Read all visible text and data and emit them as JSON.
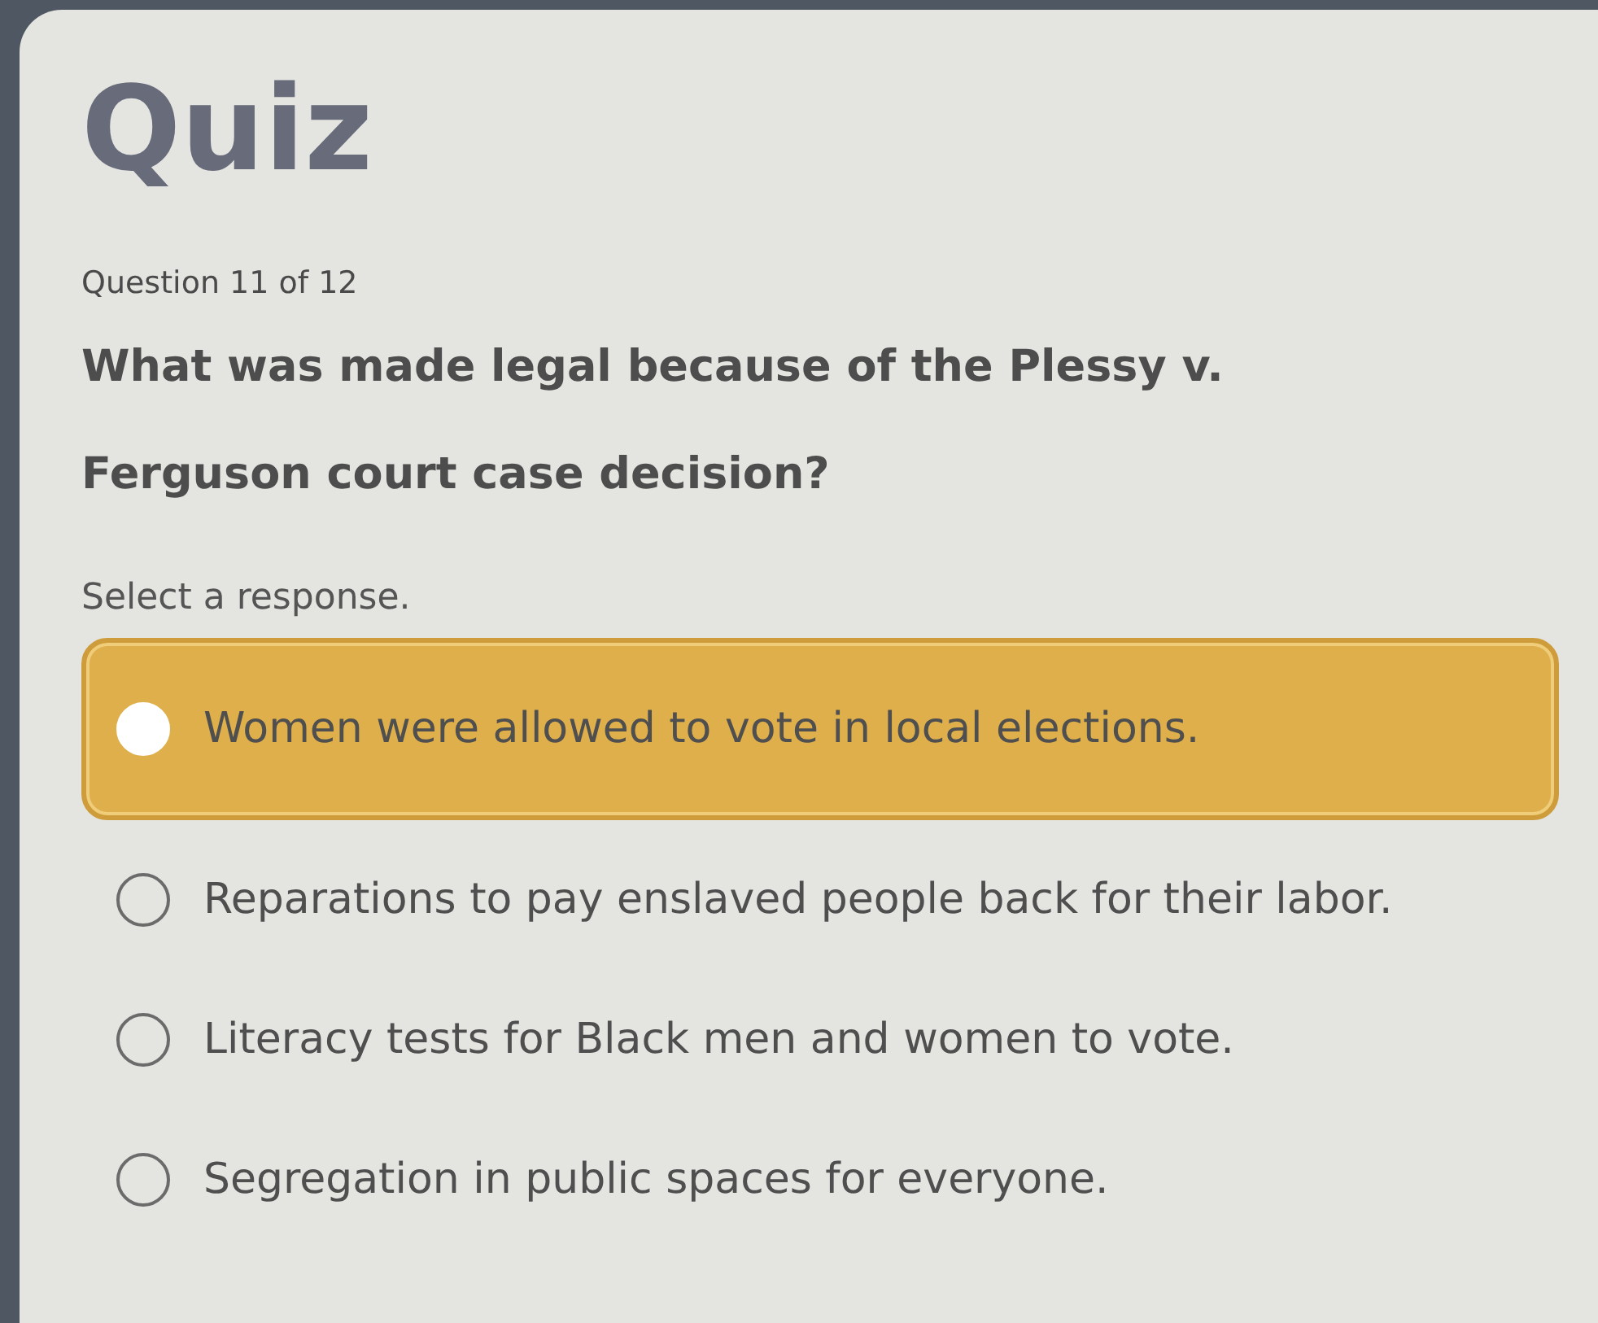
{
  "title": "Quiz",
  "progress": "Question 11 of 12",
  "question": "What was made legal because of the Plessy v. Ferguson court case decision?",
  "instruction": "Select a response.",
  "options": [
    {
      "label": "Women were allowed to vote in local elections.",
      "selected": true
    },
    {
      "label": "Reparations to pay enslaved people back for their labor.",
      "selected": false
    },
    {
      "label": "Literacy tests for Black men and women to vote.",
      "selected": false
    },
    {
      "label": "Segregation in public spaces for everyone.",
      "selected": false
    }
  ]
}
